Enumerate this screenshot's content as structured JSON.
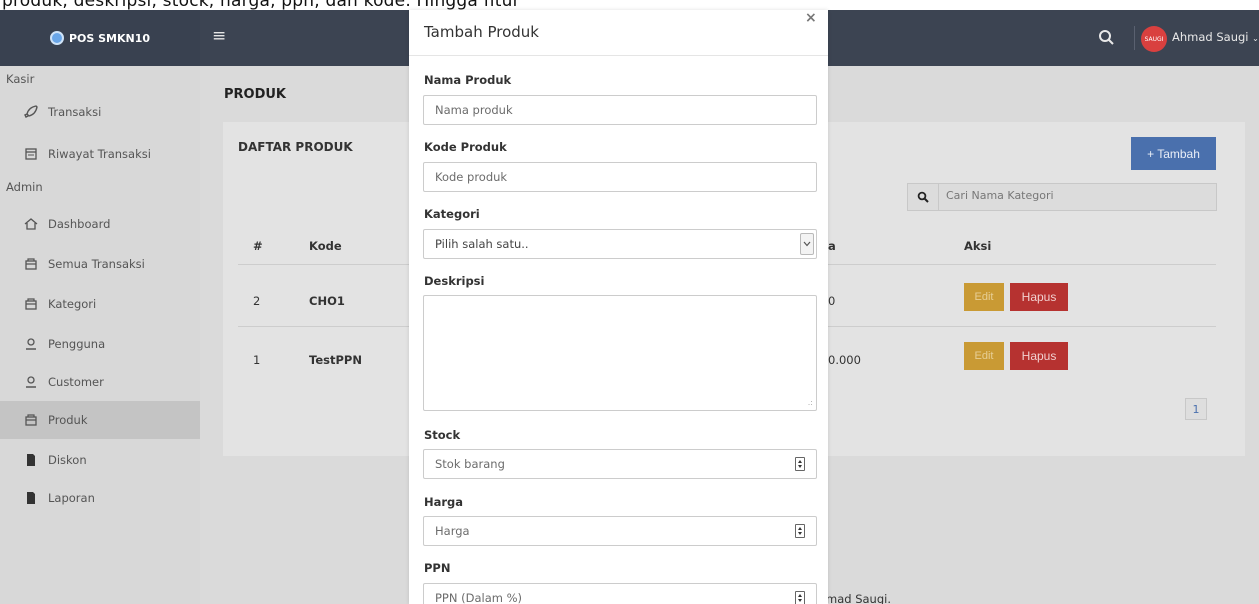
{
  "caption": "produk, deskripsi, stock, harga, ppn, dan kode. Hingga fitur",
  "navbar": {
    "brand": "POS SMKN10",
    "user_name": "Ahmad Saugi",
    "avatar_text": "SAUGI"
  },
  "sidebar": {
    "sections": [
      "Kasir",
      "Admin"
    ],
    "kasir_items": [
      {
        "label": "Transaksi",
        "icon": "rocket-icon"
      },
      {
        "label": "Riwayat Transaksi",
        "icon": "calendar-icon"
      }
    ],
    "admin_items": [
      {
        "label": "Dashboard",
        "icon": "home-icon"
      },
      {
        "label": "Semua Transaksi",
        "icon": "box-icon"
      },
      {
        "label": "Kategori",
        "icon": "box-icon"
      },
      {
        "label": "Pengguna",
        "icon": "user-icon"
      },
      {
        "label": "Customer",
        "icon": "user-icon"
      },
      {
        "label": "Produk",
        "icon": "box-icon",
        "active": true
      },
      {
        "label": "Diskon",
        "icon": "file-icon"
      },
      {
        "label": "Laporan",
        "icon": "file-icon"
      }
    ]
  },
  "main": {
    "page_title": "PRODUK",
    "card_title": "DAFTAR PRODUK",
    "add_button": "+ Tambah",
    "search_placeholder": "Cari Nama Kategori",
    "table": {
      "headers": {
        "no": "#",
        "kode": "Kode",
        "harga_partial": "a",
        "aksi": "Aksi"
      },
      "rows": [
        {
          "no": "2",
          "kode": "CHO1",
          "harga_partial": "0"
        },
        {
          "no": "1",
          "kode": "TestPPN",
          "harga_partial": "0.000"
        }
      ],
      "edit_label": "Edit",
      "delete_label": "Hapus"
    },
    "pagination": {
      "current": "1"
    },
    "footer_partial": "mad Saugi."
  },
  "modal": {
    "title": "Tambah Produk",
    "close": "×",
    "fields": {
      "nama": {
        "label": "Nama Produk",
        "placeholder": "Nama produk",
        "value": ""
      },
      "kode": {
        "label": "Kode Produk",
        "placeholder": "Kode produk",
        "value": ""
      },
      "kategori": {
        "label": "Kategori",
        "selected": "Pilih salah satu.."
      },
      "deskripsi": {
        "label": "Deskripsi",
        "value": ""
      },
      "stock": {
        "label": "Stock",
        "placeholder": "Stok barang",
        "value": ""
      },
      "harga": {
        "label": "Harga",
        "placeholder": "Harga",
        "value": ""
      },
      "ppn": {
        "label": "PPN",
        "placeholder": "PPN (Dalam %)",
        "value": ""
      }
    }
  },
  "colors": {
    "navbar": "#3c4452",
    "sidebar": "#d8d8d8",
    "primary": "#4a70ad",
    "warning": "#c99a34",
    "danger": "#b63230"
  }
}
